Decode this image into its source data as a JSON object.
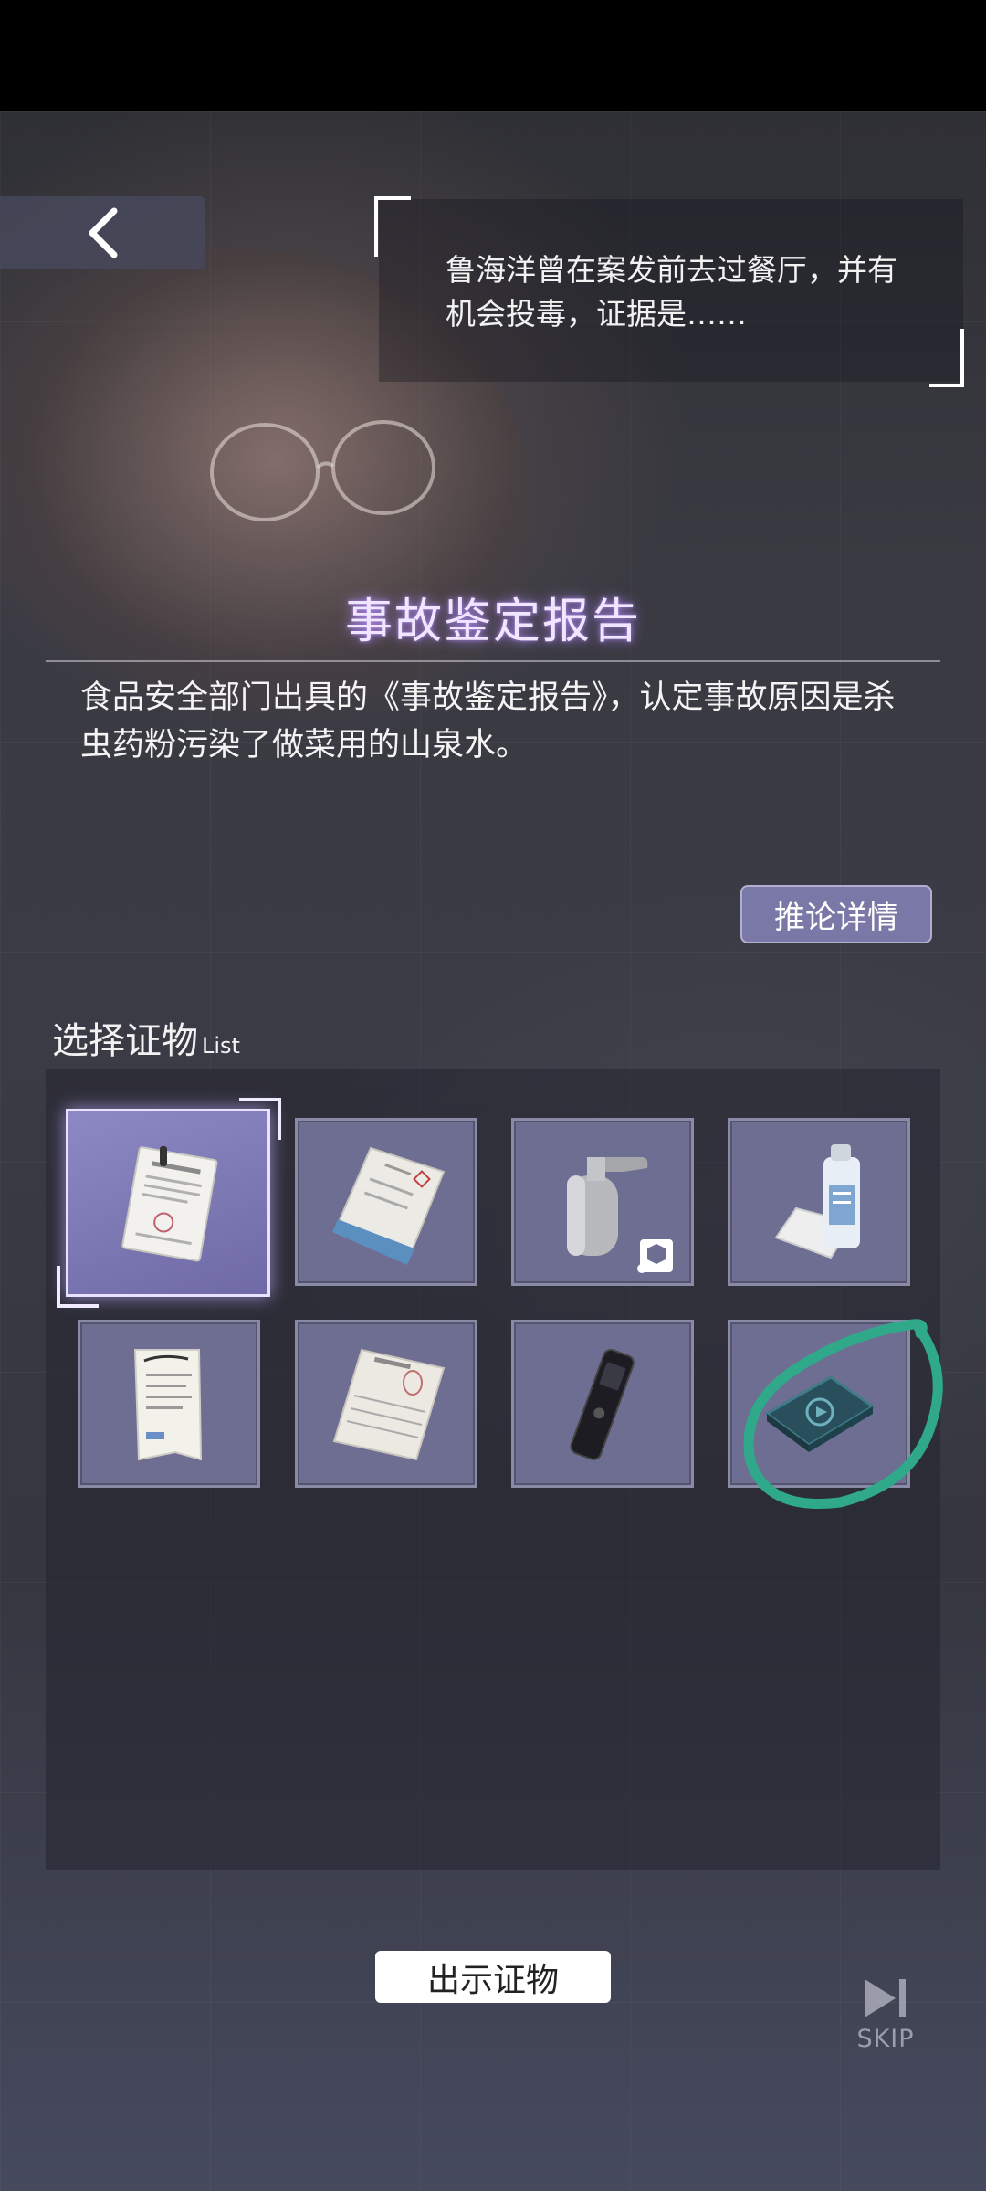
{
  "hint": {
    "text": "鲁海洋曾在案发前去过餐厅，并有机会投毒，证据是……"
  },
  "evidence": {
    "title": "事故鉴定报告",
    "description": "食品安全部门出具的《事故鉴定报告》，认定事故原因是杀虫药粉污染了做菜用的山泉水。",
    "detail_button": "推论详情"
  },
  "list": {
    "title": "选择证物",
    "subtitle": "List",
    "items": [
      {
        "icon": "report-document-icon",
        "selected": true
      },
      {
        "icon": "open-file-folder-icon",
        "selected": false
      },
      {
        "icon": "soap-dispenser-icon",
        "selected": false,
        "badge": "cube-icon"
      },
      {
        "icon": "pesticide-bottle-icon",
        "selected": false
      },
      {
        "icon": "receipt-icon",
        "selected": false
      },
      {
        "icon": "fingerprint-record-icon",
        "selected": false
      },
      {
        "icon": "voice-recorder-icon",
        "selected": false
      },
      {
        "icon": "video-card-icon",
        "selected": false,
        "annotation": "green-circle-mark"
      }
    ]
  },
  "actions": {
    "present_button": "出示证物",
    "skip_label": "SKIP"
  },
  "colors": {
    "title_glow": "#b48cff",
    "slot_fill": "#6e6d92",
    "detail_button": "#7a78a6",
    "annotation_green": "#2fa98a"
  }
}
